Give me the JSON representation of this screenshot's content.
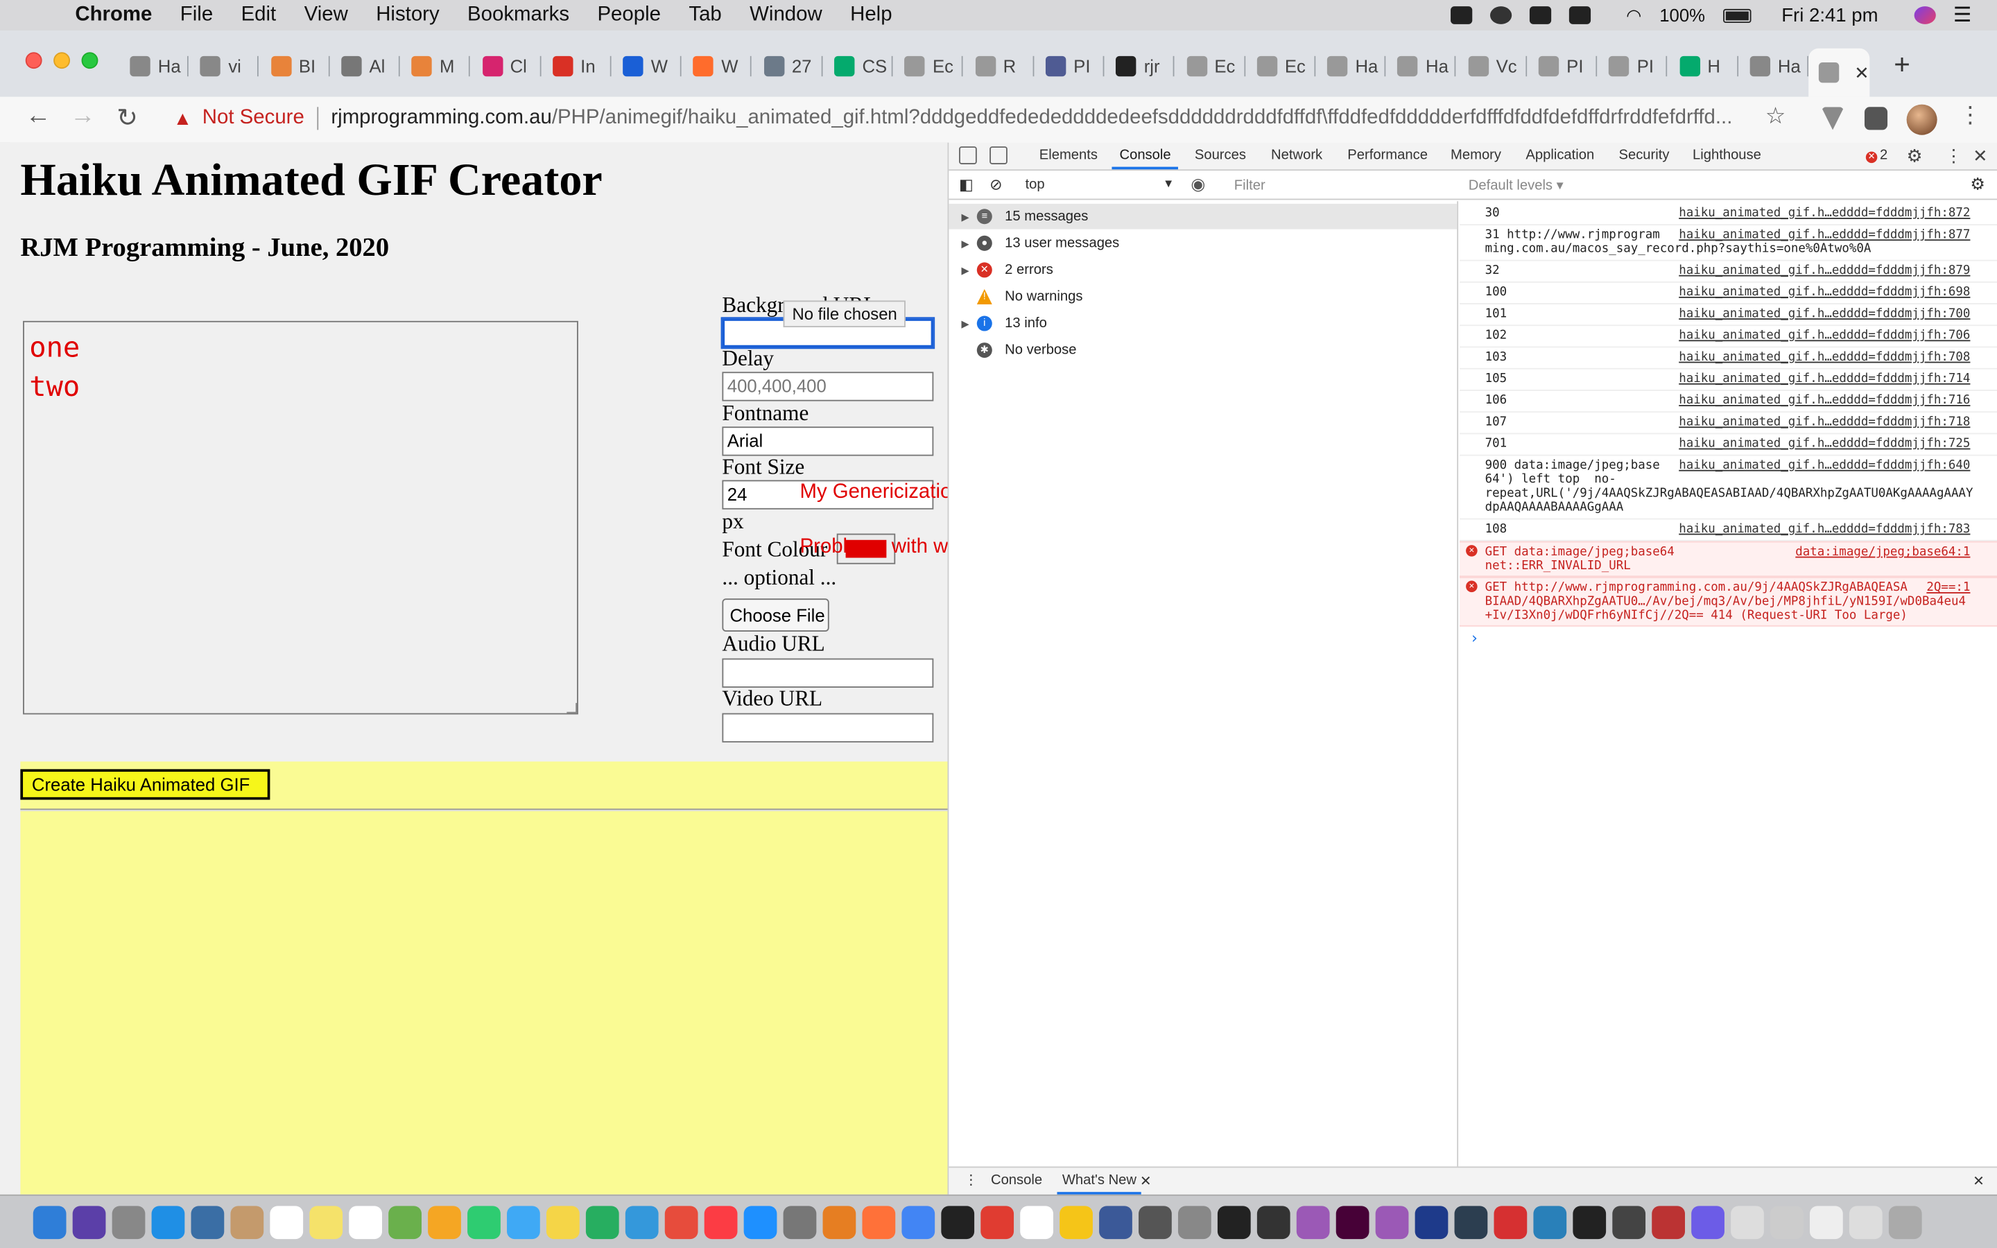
{
  "menubar": {
    "app_name": "Chrome",
    "items": [
      "File",
      "Edit",
      "View",
      "History",
      "Bookmarks",
      "People",
      "Tab",
      "Window",
      "Help"
    ],
    "battery": "100%",
    "clock": "Fri 2:41 pm"
  },
  "browser": {
    "tabs": [
      {
        "label": "Ha",
        "icon": "github-icon",
        "color": "#888888"
      },
      {
        "label": "vi",
        "icon": "github-icon",
        "color": "#888888"
      },
      {
        "label": "BI",
        "icon": "hub-icon",
        "color": "#e8833a"
      },
      {
        "label": "Al",
        "icon": "apple-icon",
        "color": "#777777"
      },
      {
        "label": "M",
        "icon": "hub-icon",
        "color": "#e8833a"
      },
      {
        "label": "Cl",
        "icon": "pink-icon",
        "color": "#d6246e"
      },
      {
        "label": "In",
        "icon": "gmail-icon",
        "color": "#d93025"
      },
      {
        "label": "W",
        "icon": "globe-icon",
        "color": "#1a5fd6"
      },
      {
        "label": "W",
        "icon": "cpanel-icon",
        "color": "#ff6c2c"
      },
      {
        "label": "27",
        "icon": "pma-icon",
        "color": "#6c7a89"
      },
      {
        "label": "CS",
        "icon": "w3-icon",
        "color": "#04aa6d"
      },
      {
        "label": "Ec",
        "icon": "rocket-icon",
        "color": "#999999"
      },
      {
        "label": "R",
        "icon": "rocket-icon",
        "color": "#999999"
      },
      {
        "label": "PI",
        "icon": "php-icon",
        "color": "#4f5b93"
      },
      {
        "label": "rjr",
        "icon": "amazon-icon",
        "color": "#222222"
      },
      {
        "label": "Ec",
        "icon": "rocket-icon",
        "color": "#999999"
      },
      {
        "label": "Ec",
        "icon": "rocket-icon",
        "color": "#999999"
      },
      {
        "label": "Ha",
        "icon": "rocket-icon",
        "color": "#999999"
      },
      {
        "label": "Ha",
        "icon": "rocket-icon",
        "color": "#999999"
      },
      {
        "label": "Vc",
        "icon": "rocket-icon",
        "color": "#999999"
      },
      {
        "label": "PI",
        "icon": "rocket-icon",
        "color": "#999999"
      },
      {
        "label": "PI",
        "icon": "rocket-icon",
        "color": "#999999"
      },
      {
        "label": "H",
        "icon": "w3-icon",
        "color": "#04aa6d"
      },
      {
        "label": "Ha",
        "icon": "github-icon",
        "color": "#888888"
      }
    ],
    "active_tab_icon": "rocket-icon",
    "not_secure": "Not Secure",
    "url_host": "rjmprogramming.com.au",
    "url_rest": "/PHP/animegif/haiku_animated_gif.html?dddgeddfedededdddedeefsddddddrdddfdffdf\\ffddfedfddddderfdfffdfddfdefdffdrfrddfefdrffd..."
  },
  "page": {
    "title": "Haiku Animated GIF Creator",
    "subtitle": "RJM Programming - June, 2020",
    "haiku_text": "one\ntwo",
    "labels": {
      "background_url": "Background URL",
      "delay": "Delay",
      "fontname": "Fontname",
      "font_size": "Font Size",
      "px": "px",
      "font_colour": "Font Colour",
      "optional": "... optional ...",
      "audio_url": "Audio URL",
      "video_url": "Video URL"
    },
    "values": {
      "delay_placeholder": "400,400,400",
      "fontname": "Arial",
      "font_size": "24"
    },
    "tooltip": "No file chosen",
    "choose_file": "Choose File",
    "overlay_1": "My Genericization of Haiku ...",
    "overlay_2": "Problems with web application execution",
    "create_button": "Create Haiku Animated GIF",
    "font_colour_value": "#e00000"
  },
  "devtools": {
    "tabs": [
      "Elements",
      "Console",
      "Sources",
      "Network",
      "Performance",
      "Memory",
      "Application",
      "Security",
      "Lighthouse"
    ],
    "active_tab": "Console",
    "error_count": "2",
    "context": "top",
    "filter_placeholder": "Filter",
    "levels": "Default levels ▾",
    "sidebar": [
      {
        "label": "15 messages",
        "icon": "list-icon"
      },
      {
        "label": "13 user messages",
        "icon": "user-icon"
      },
      {
        "label": "2 errors",
        "icon": "error-icon"
      },
      {
        "label": "No warnings",
        "icon": "warning-icon"
      },
      {
        "label": "13 info",
        "icon": "info-icon"
      },
      {
        "label": "No verbose",
        "icon": "bug-icon"
      }
    ],
    "console_rows": [
      {
        "msg": "30",
        "src": "haiku_animated_gif.h…edddd=fdddmjjfh:872"
      },
      {
        "msg": "31 http://www.rjmprogram\nming.com.au/macos_say_record.php?saythis=one%0Atwo%0A",
        "src": "haiku_animated_gif.h…edddd=fdddmjjfh:877"
      },
      {
        "msg": "32",
        "src": "haiku_animated_gif.h…edddd=fdddmjjfh:879"
      },
      {
        "msg": "100",
        "src": "haiku_animated_gif.h…edddd=fdddmjjfh:698"
      },
      {
        "msg": "101",
        "src": "haiku_animated_gif.h…edddd=fdddmjjfh:700"
      },
      {
        "msg": "102",
        "src": "haiku_animated_gif.h…edddd=fdddmjjfh:706"
      },
      {
        "msg": "103",
        "src": "haiku_animated_gif.h…edddd=fdddmjjfh:708"
      },
      {
        "msg": "105",
        "src": "haiku_animated_gif.h…edddd=fdddmjjfh:714"
      },
      {
        "msg": "106",
        "src": "haiku_animated_gif.h…edddd=fdddmjjfh:716"
      },
      {
        "msg": "107",
        "src": "haiku_animated_gif.h…edddd=fdddmjjfh:718"
      },
      {
        "msg": "701",
        "src": "haiku_animated_gif.h…edddd=fdddmjjfh:725"
      },
      {
        "msg": "900 data:image/jpeg;base\n64') left top  no-\nrepeat,URL('/9j/4AAQSkZJRgABAQEASABIAAD/4QBARXhpZgAATU0AKgAAAAgAAAY\ndpAAQAAAABAAAAGgAAA",
        "src": "haiku_animated_gif.h…edddd=fdddmjjfh:640"
      },
      {
        "msg": "108",
        "src": "haiku_animated_gif.h…edddd=fdddmjjfh:783"
      }
    ],
    "error_rows": [
      {
        "msg": "GET data:image/jpeg;base64\nnet::ERR_INVALID_URL",
        "src": "data:image/jpeg;base64:1"
      },
      {
        "msg": "GET http://www.rjmprogramming.com.au/9j/4AAQSkZJRgABAQEASA\nBIAAD/4QBARXhpZgAATU0…/Av/bej/mq3/Av/bej/MP8jhfiL/yN159I/wD0Ba4eu4\n+Iv/I3Xn0j/wDQFrh6yNIfCj//2Q== 414 (Request-URI Too Large)",
        "src": "2Q==:1"
      }
    ],
    "drawer_tabs": [
      "Console",
      "What's New"
    ]
  },
  "dock": {
    "colors": [
      "#2f7ed8",
      "#5b3fa8",
      "#888",
      "#1f8fe5",
      "#3a6ea5",
      "#c49a6c",
      "#fff",
      "#f5e26a",
      "#fff",
      "#6ab04c",
      "#f5a623",
      "#2ecc71",
      "#3fa9f5",
      "#f5d547",
      "#27ae60",
      "#3498db",
      "#e74c3c",
      "#fc3c44",
      "#1e90ff",
      "#777",
      "#e67e22",
      "#ff7139",
      "#4285f4",
      "#222",
      "#e03c31",
      "#fff",
      "#f5c518",
      "#3b5998",
      "#555",
      "#888",
      "#222",
      "#333",
      "#9b59b6",
      "#470137",
      "#9b59b6",
      "#1e3a8a",
      "#2c3e50",
      "#d63031",
      "#2980b9",
      "#222",
      "#444",
      "#b33",
      "#6c5ce7",
      "#ddd",
      "#ccc",
      "#eee",
      "#ddd",
      "#aaa"
    ]
  }
}
